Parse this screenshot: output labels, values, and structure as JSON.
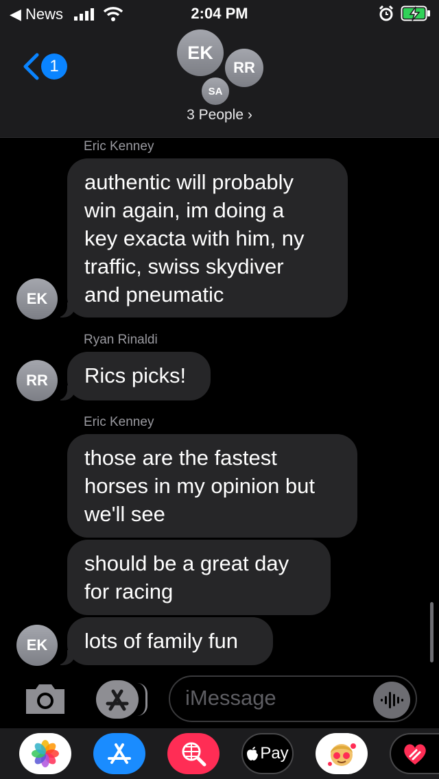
{
  "status_bar": {
    "back_app": "◀ News",
    "time": "2:04 PM"
  },
  "header": {
    "back_badge": "1",
    "avatars": [
      "EK",
      "RR",
      "SA"
    ],
    "people_label": "3 People ›"
  },
  "messages": [
    {
      "sender": "Eric Kenney",
      "avatar": "EK",
      "lines": [
        "authentic will probably",
        "win again, im doing a",
        "key exacta with him, ny",
        "traffic, swiss skydiver",
        "and pneumatic"
      ]
    },
    {
      "sender": "Ryan Rinaldi",
      "avatar": "RR",
      "lines": [
        "Rics picks!"
      ]
    },
    {
      "sender": "Eric Kenney",
      "avatar": "EK",
      "lines": [
        "those are the fastest",
        "horses in my opinion but",
        "we'll see"
      ]
    },
    {
      "lines": [
        "should be a great day",
        "for racing"
      ]
    },
    {
      "lines": [
        "lots of family fun"
      ]
    }
  ],
  "input": {
    "placeholder": "iMessage"
  },
  "app_strip": {
    "apple_pay": "Pay"
  },
  "colors": {
    "accent": "#0a84ff",
    "bubble": "#262628",
    "background": "#000000"
  }
}
